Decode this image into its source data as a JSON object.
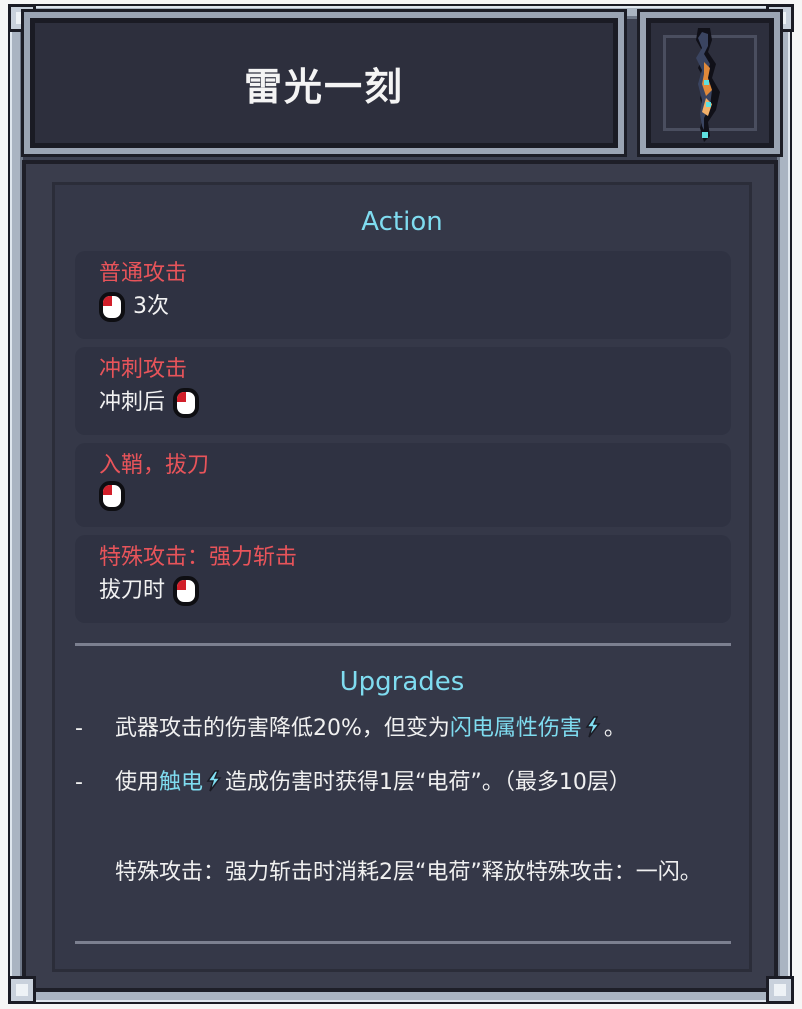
{
  "header": {
    "title": "雷光一刻",
    "weapon_icon": "katana-icon"
  },
  "action": {
    "section_title": "Action",
    "items": [
      {
        "title": "普通攻击",
        "before_text": "",
        "after_text": "3次",
        "icon": "mouse-left-click-icon"
      },
      {
        "title": "冲刺攻击",
        "before_text": "冲刺后",
        "after_text": "",
        "icon": "mouse-left-click-icon"
      },
      {
        "title": "入鞘，拔刀",
        "before_text": "",
        "after_text": "",
        "icon": "mouse-left-click-icon"
      },
      {
        "title": "特殊攻击：强力斩击",
        "before_text": "拔刀时",
        "after_text": "",
        "icon": "mouse-left-click-icon"
      }
    ]
  },
  "upgrades": {
    "section_title": "Upgrades",
    "bullet": "-",
    "item1": {
      "text_a": "武器攻击的伤害降低20%，但变为",
      "highlight": "闪电属性伤害",
      "text_b": "。"
    },
    "item2": {
      "text_a": "使用",
      "highlight": "触电",
      "text_b": "造成伤害时获得1层“电荷”。（最多10层）"
    },
    "item3": {
      "text": "特殊攻击：强力斩击时消耗2层“电荷”释放特殊攻击：一闪。"
    }
  },
  "colors": {
    "accent_cyan": "#7fdcf0",
    "title_red": "#e8545a",
    "panel": "#353848"
  }
}
